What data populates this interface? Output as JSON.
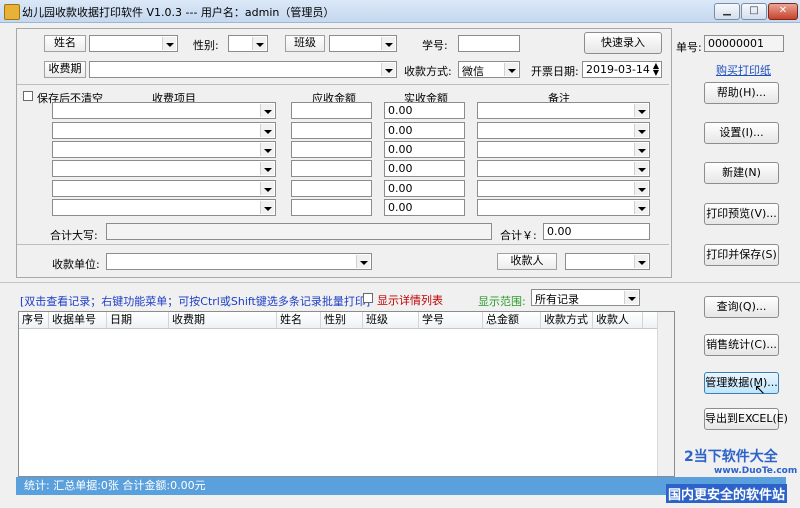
{
  "window": {
    "title": "幼儿园收款收据打印软件 V1.0.3 --- 用户名：admin（管理员）"
  },
  "form": {
    "name_label": "姓名",
    "gender_label": "性别:",
    "class_label": "班级",
    "student_no_label": "学号:",
    "quick_entry_button": "快速录入",
    "fee_period_label": "收费期",
    "pay_method_label": "收款方式:",
    "pay_method_value": "微信",
    "issue_date_label": "开票日期:",
    "issue_date_value": "2019-03-14",
    "keep_after_save_label": "保存后不清空",
    "col_item": "收费项目",
    "col_due": "应收金额",
    "col_actual": "实收金额",
    "col_note": "备注",
    "rows": [
      {
        "actual": "0.00"
      },
      {
        "actual": "0.00"
      },
      {
        "actual": "0.00"
      },
      {
        "actual": "0.00"
      },
      {
        "actual": "0.00"
      },
      {
        "actual": "0.00"
      }
    ],
    "total_caps_label": "合计大写:",
    "total_label": "合计￥:",
    "total_value": "0.00",
    "payer_unit_label": "收款单位:",
    "collector_label": "收款人"
  },
  "side": {
    "receipt_no_label": "单号:",
    "receipt_no_value": "00000001",
    "buy_paper_link": "购买打印纸",
    "help_button": "帮助(H)...",
    "settings_button": "设置(I)...",
    "new_button": "新建(N)",
    "print_preview_button": "打印预览(V)...",
    "print_save_button": "打印并保存(S)",
    "query_button": "查询(Q)...",
    "sales_stats_button": "销售统计(C)...",
    "manage_data_button": "管理数据(M)...",
    "export_excel_button": "导出到EXCEL(E)"
  },
  "records": {
    "hint": "[双击查看记录；右键功能菜单；可按Ctrl或Shift键选多条记录批量打印]",
    "show_detail_label": "显示详情列表",
    "range_label": "显示范围:",
    "range_value": "所有记录",
    "columns": [
      "序号",
      "收据单号",
      "日期",
      "收费期",
      "姓名",
      "性别",
      "班级",
      "学号",
      "总金额",
      "收款方式",
      "收款人"
    ]
  },
  "status": {
    "summary": "统计: 汇总单据:0张 合计金额:0.00元"
  },
  "watermark": {
    "brand_top": "2当下软件大全",
    "url": "www.DuoTe.com",
    "slogan": "国内更安全的软件站"
  },
  "colors": {
    "accent_blue": "#1f4fbf",
    "status_bar": "#5aa0dd",
    "hint_blue": "#1e3ec8",
    "range_green": "#2a9a2a",
    "detail_red": "#c00000"
  }
}
